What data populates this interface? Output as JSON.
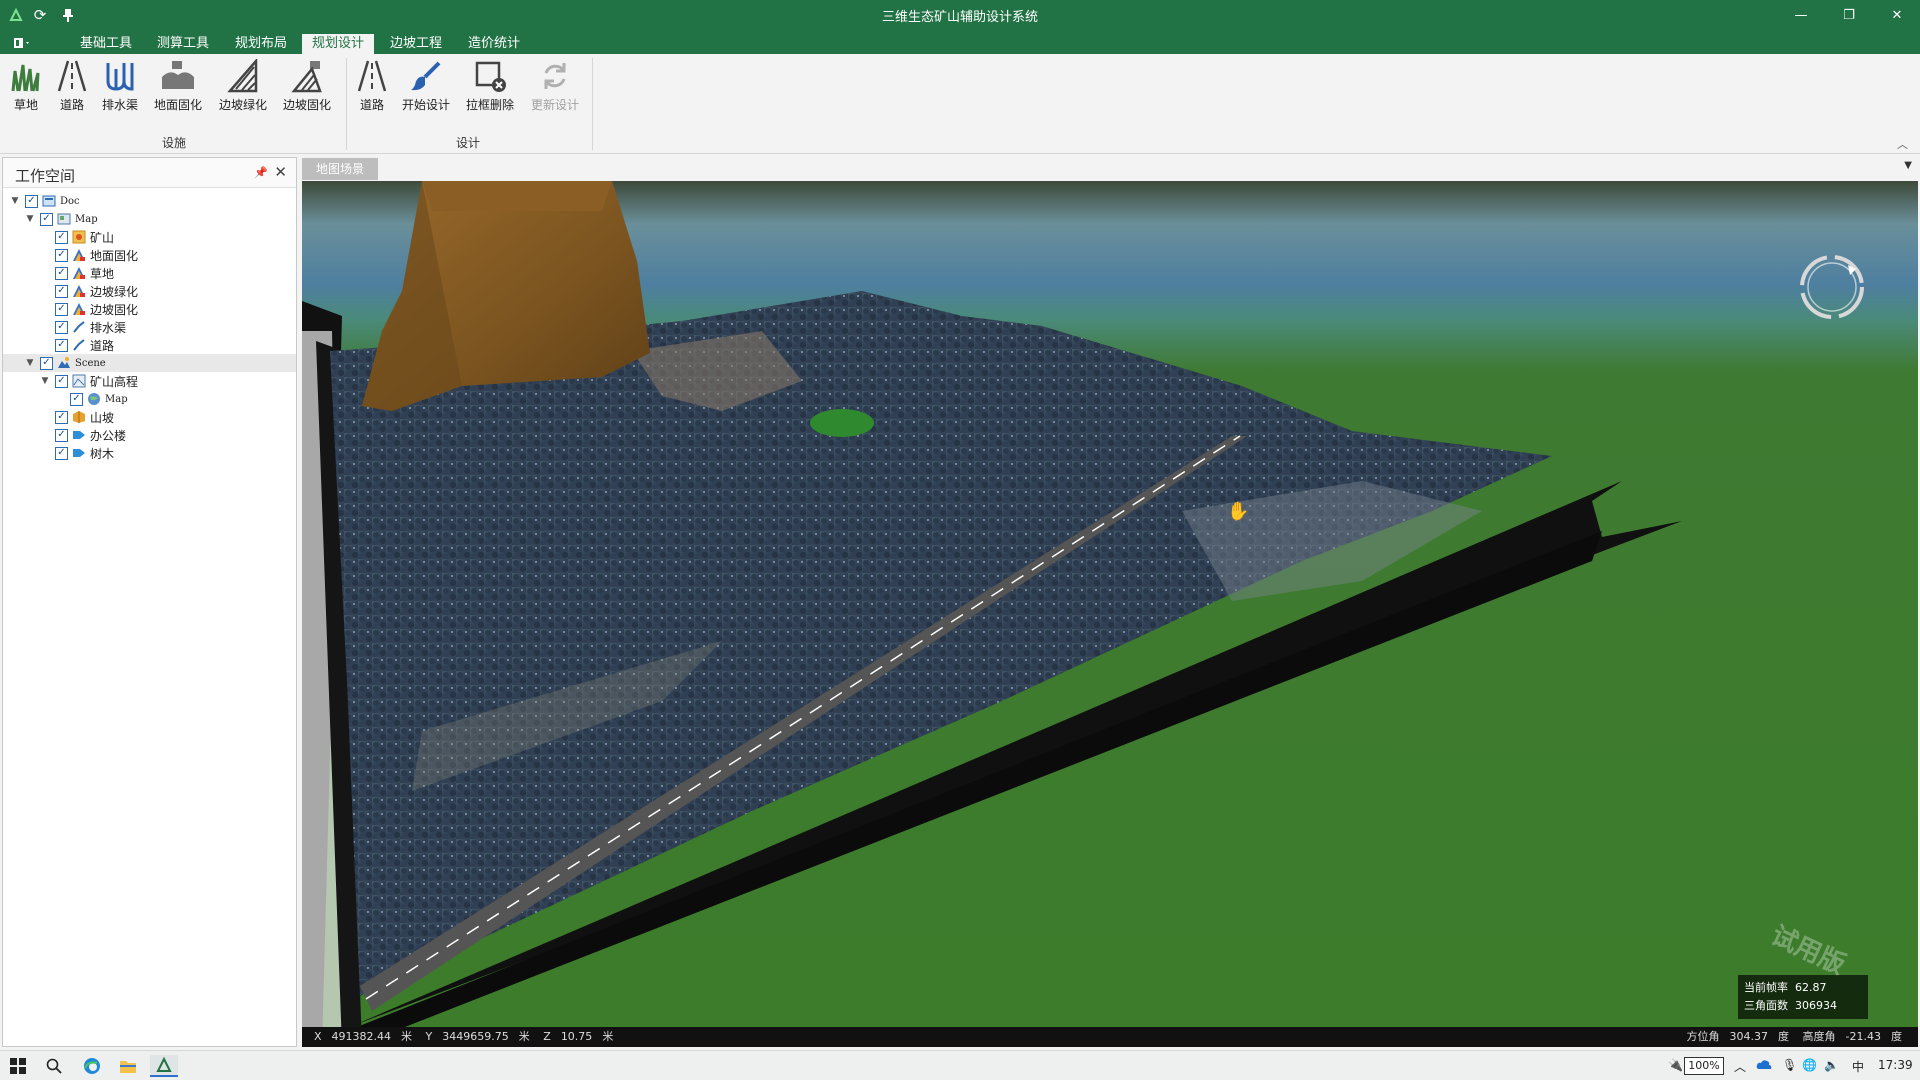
{
  "app": {
    "title": "三维生态矿山辅助设计系统"
  },
  "window_controls": {
    "minimize": "—",
    "restore": "❐",
    "close": "✕"
  },
  "quick_access": [
    "app-logo-icon",
    "refresh-icon",
    "pin-icon"
  ],
  "menu": {
    "tabs": [
      "基础工具",
      "测算工具",
      "规划布局",
      "规划设计",
      "边坡工程",
      "造价统计"
    ],
    "active": "规划设计"
  },
  "ribbon": {
    "group1": {
      "label": "设施",
      "buttons": [
        "草地",
        "道路",
        "排水渠",
        "地面固化",
        "边坡绿化",
        "边坡固化"
      ]
    },
    "group2": {
      "label": "设计",
      "buttons": [
        "道路",
        "开始设计",
        "拉框删除",
        "更新设计"
      ]
    }
  },
  "workspace": {
    "title": "工作空间",
    "tree": [
      {
        "label": "Doc",
        "level": 0,
        "expand": "▼",
        "icon": "doc-icon"
      },
      {
        "label": "Map",
        "level": 1,
        "expand": "▼",
        "icon": "map-icon"
      },
      {
        "label": "矿山",
        "level": 2,
        "icon": "mine-layer-icon"
      },
      {
        "label": "地面固化",
        "level": 2,
        "icon": "region-layer-icon"
      },
      {
        "label": "草地",
        "level": 2,
        "icon": "region-layer-icon"
      },
      {
        "label": "边坡绿化",
        "level": 2,
        "icon": "region-layer-icon"
      },
      {
        "label": "边坡固化",
        "level": 2,
        "icon": "region-layer-icon"
      },
      {
        "label": "排水渠",
        "level": 2,
        "icon": "line-layer-icon"
      },
      {
        "label": "道路",
        "level": 2,
        "icon": "line-layer-icon"
      },
      {
        "label": "Scene",
        "level": 1,
        "expand": "▼",
        "icon": "scene-icon",
        "selected": true
      },
      {
        "label": "矿山高程",
        "level": 2,
        "expand": "▼",
        "icon": "elevation-icon"
      },
      {
        "label": "Map",
        "level": 3,
        "icon": "globe-icon"
      },
      {
        "label": "山坡",
        "level": 2,
        "icon": "model-icon"
      },
      {
        "label": "办公楼",
        "level": 2,
        "icon": "building-icon"
      },
      {
        "label": "树木",
        "level": 2,
        "icon": "building-icon"
      }
    ]
  },
  "scene": {
    "tab": "地图场景",
    "stats": {
      "fps_label": "当前帧率",
      "fps": "62.87",
      "tri_label": "三角面数",
      "tri": "306934"
    },
    "watermark": "试用版",
    "status": {
      "x_label": "X",
      "x": "491382.44",
      "x_unit": "米",
      "y_label": "Y",
      "y": "3449659.75",
      "y_unit": "米",
      "z_label": "Z",
      "z": "10.75",
      "z_unit": "米",
      "azimuth_label": "方位角",
      "azimuth": "304.37",
      "azimuth_unit": "度",
      "altitude_label": "高度角",
      "altitude": "-21.43",
      "altitude_unit": "度"
    }
  },
  "taskbar": {
    "battery": "100%",
    "ime": "中",
    "time": "17:39"
  }
}
